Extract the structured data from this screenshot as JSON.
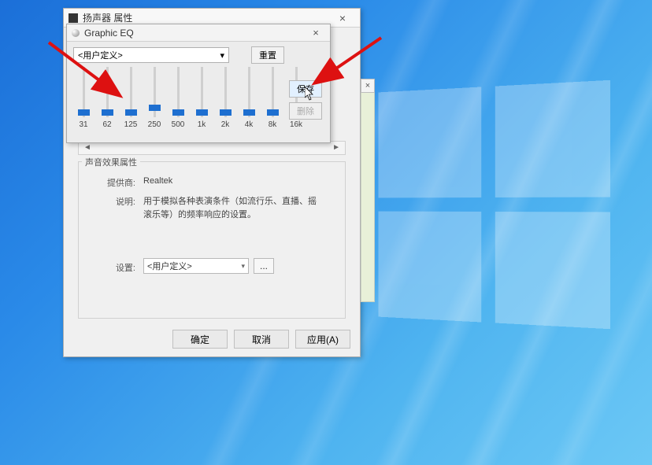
{
  "prop": {
    "title": "扬声器 属性",
    "tabstrip_left_arrow": "◄",
    "tabstrip_right_arrow": "►",
    "group_title": "声音效果属性",
    "provider_label": "提供商:",
    "provider_value": "Realtek",
    "desc_label": "说明:",
    "desc_value": "用于模拟各种表演条件（如流行乐、直播、摇滚乐等）的频率响应的设置。",
    "setting_label": "设置:",
    "setting_value": "<用户定义>",
    "dots": "...",
    "ok": "确定",
    "cancel": "取消",
    "apply": "应用(A)"
  },
  "eq": {
    "title": "Graphic EQ",
    "preset": "<用户定义>",
    "reset": "重置",
    "save": "保存",
    "delete": "删除",
    "bands": [
      {
        "freq": "31",
        "pos": 54
      },
      {
        "freq": "62",
        "pos": 54
      },
      {
        "freq": "125",
        "pos": 54
      },
      {
        "freq": "250",
        "pos": 48
      },
      {
        "freq": "500",
        "pos": 54
      },
      {
        "freq": "1k",
        "pos": 54
      },
      {
        "freq": "2k",
        "pos": 54
      },
      {
        "freq": "4k",
        "pos": 54
      },
      {
        "freq": "8k",
        "pos": 54
      },
      {
        "freq": "16k",
        "pos": 54
      }
    ]
  },
  "hint_close": "×"
}
